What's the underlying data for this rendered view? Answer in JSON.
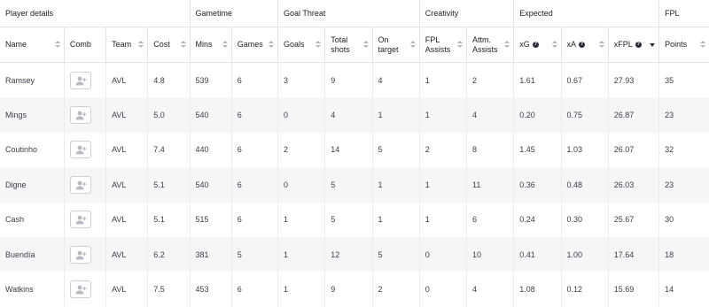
{
  "groups": [
    "Player details",
    "Gametime",
    "Goal Threat",
    "Creativity",
    "Expected",
    "FPL"
  ],
  "headers": {
    "name": "Name",
    "comb": "Comb",
    "team": "Team",
    "cost": "Cost",
    "mins": "Mins",
    "games": "Games",
    "goals": "Goals",
    "total_shots_1": "Total",
    "total_shots_2": "shots",
    "on_target_1": "On",
    "on_target_2": "target",
    "fpl_assists_1": "FPL",
    "fpl_assists_2": "Assists",
    "attm_assists_1": "Attm.",
    "attm_assists_2": "Assists",
    "xg": "xG",
    "xa": "xA",
    "xfpl": "xFPL",
    "points": "Points",
    "help_glyph": "?"
  },
  "rows": [
    {
      "name": "Ramsey",
      "team": "AVL",
      "cost": "4.8",
      "mins": "539",
      "games": "6",
      "goals": "3",
      "shots": "9",
      "on_target": "4",
      "fpl_assists": "1",
      "attm_assists": "2",
      "xg": "1.61",
      "xa": "0.67",
      "xfpl": "27.93",
      "points": "35"
    },
    {
      "name": "Mings",
      "team": "AVL",
      "cost": "5.0",
      "mins": "540",
      "games": "6",
      "goals": "0",
      "shots": "4",
      "on_target": "1",
      "fpl_assists": "1",
      "attm_assists": "4",
      "xg": "0.20",
      "xa": "0.75",
      "xfpl": "26.87",
      "points": "23"
    },
    {
      "name": "Coutinho",
      "team": "AVL",
      "cost": "7.4",
      "mins": "440",
      "games": "6",
      "goals": "2",
      "shots": "14",
      "on_target": "5",
      "fpl_assists": "2",
      "attm_assists": "8",
      "xg": "1.45",
      "xa": "1.03",
      "xfpl": "26.07",
      "points": "32"
    },
    {
      "name": "Digne",
      "team": "AVL",
      "cost": "5.1",
      "mins": "540",
      "games": "6",
      "goals": "0",
      "shots": "5",
      "on_target": "1",
      "fpl_assists": "1",
      "attm_assists": "11",
      "xg": "0.36",
      "xa": "0.48",
      "xfpl": "26.03",
      "points": "23"
    },
    {
      "name": "Cash",
      "team": "AVL",
      "cost": "5.1",
      "mins": "515",
      "games": "6",
      "goals": "1",
      "shots": "5",
      "on_target": "1",
      "fpl_assists": "1",
      "attm_assists": "6",
      "xg": "0.24",
      "xa": "0.30",
      "xfpl": "25.67",
      "points": "30"
    },
    {
      "name": "Buendía",
      "team": "AVL",
      "cost": "6.2",
      "mins": "381",
      "games": "5",
      "goals": "1",
      "shots": "12",
      "on_target": "5",
      "fpl_assists": "0",
      "attm_assists": "10",
      "xg": "0.41",
      "xa": "1.00",
      "xfpl": "17.64",
      "points": "18"
    },
    {
      "name": "Watkins",
      "team": "AVL",
      "cost": "7.5",
      "mins": "453",
      "games": "6",
      "goals": "1",
      "shots": "9",
      "on_target": "2",
      "fpl_assists": "0",
      "attm_assists": "4",
      "xg": "1.08",
      "xa": "0.12",
      "xfpl": "15.69",
      "points": "14"
    }
  ],
  "icons": {
    "comb_button": "add-user-icon",
    "sort": "sort-icon",
    "help": "help-icon"
  },
  "colors": {
    "text": "#2b2b3a",
    "stripe": "#f6f6f8",
    "border": "#e4e4e8"
  }
}
